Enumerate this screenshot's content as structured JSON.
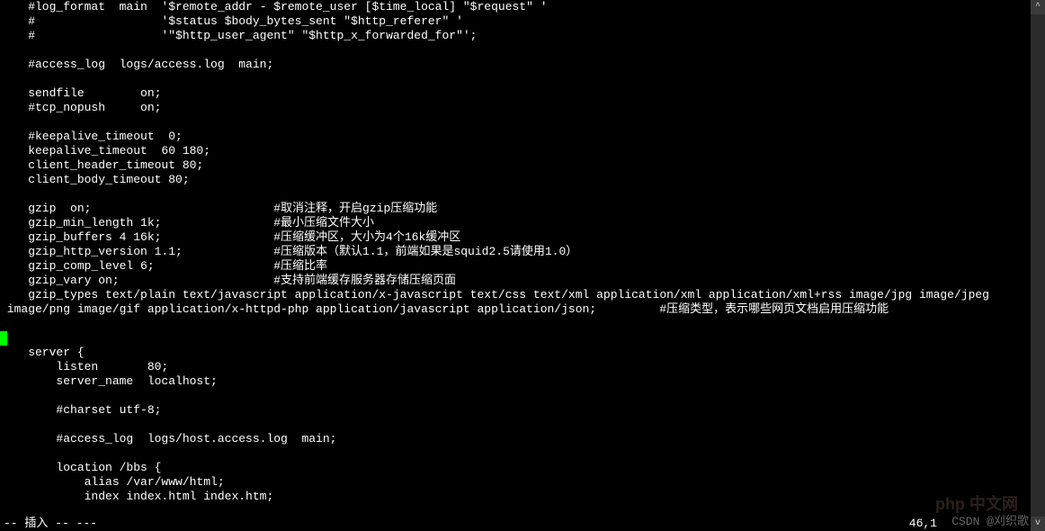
{
  "lines": [
    "    #log_format  main  '$remote_addr - $remote_user [$time_local] \"$request\" '",
    "    #                  '$status $body_bytes_sent \"$http_referer\" '",
    "    #                  '\"$http_user_agent\" \"$http_x_forwarded_for\"';",
    "",
    "    #access_log  logs/access.log  main;",
    "",
    "    sendfile        on;",
    "    #tcp_nopush     on;",
    "",
    "    #keepalive_timeout  0;",
    "    keepalive_timeout  60 180;",
    "    client_header_timeout 80;",
    "    client_body_timeout 80;",
    "",
    "    gzip  on;                          #取消注释，开启gzip压缩功能",
    "    gzip_min_length 1k;                #最小压缩文件大小",
    "    gzip_buffers 4 16k;                #压缩缓冲区，大小为4个16k缓冲区",
    "    gzip_http_version 1.1;             #压缩版本（默认1.1，前端如果是squid2.5请使用1.0）",
    "    gzip_comp_level 6;                 #压缩比率",
    "    gzip_vary on;                      #支持前端缓存服务器存储压缩页面",
    "    gzip_types text/plain text/javascript application/x-javascript text/css text/xml application/xml application/xml+rss image/jpg image/jpeg",
    " image/png image/gif application/x-httpd-php application/javascript application/json;         #压缩类型，表示哪些网页文档启用压缩功能",
    "",
    "",
    "    server {",
    "        listen       80;",
    "        server_name  localhost;",
    "",
    "        #charset utf-8;",
    "",
    "        #access_log  logs/host.access.log  main;",
    "",
    "        location /bbs {",
    "            alias /var/www/html;",
    "            index index.html index.htm;"
  ],
  "cursor_line_index": 23,
  "status": {
    "mode": "-- 插入 -- ---",
    "position": "46,1"
  },
  "watermark": "CSDN @刈织歌",
  "watermark2": "php 中文网"
}
